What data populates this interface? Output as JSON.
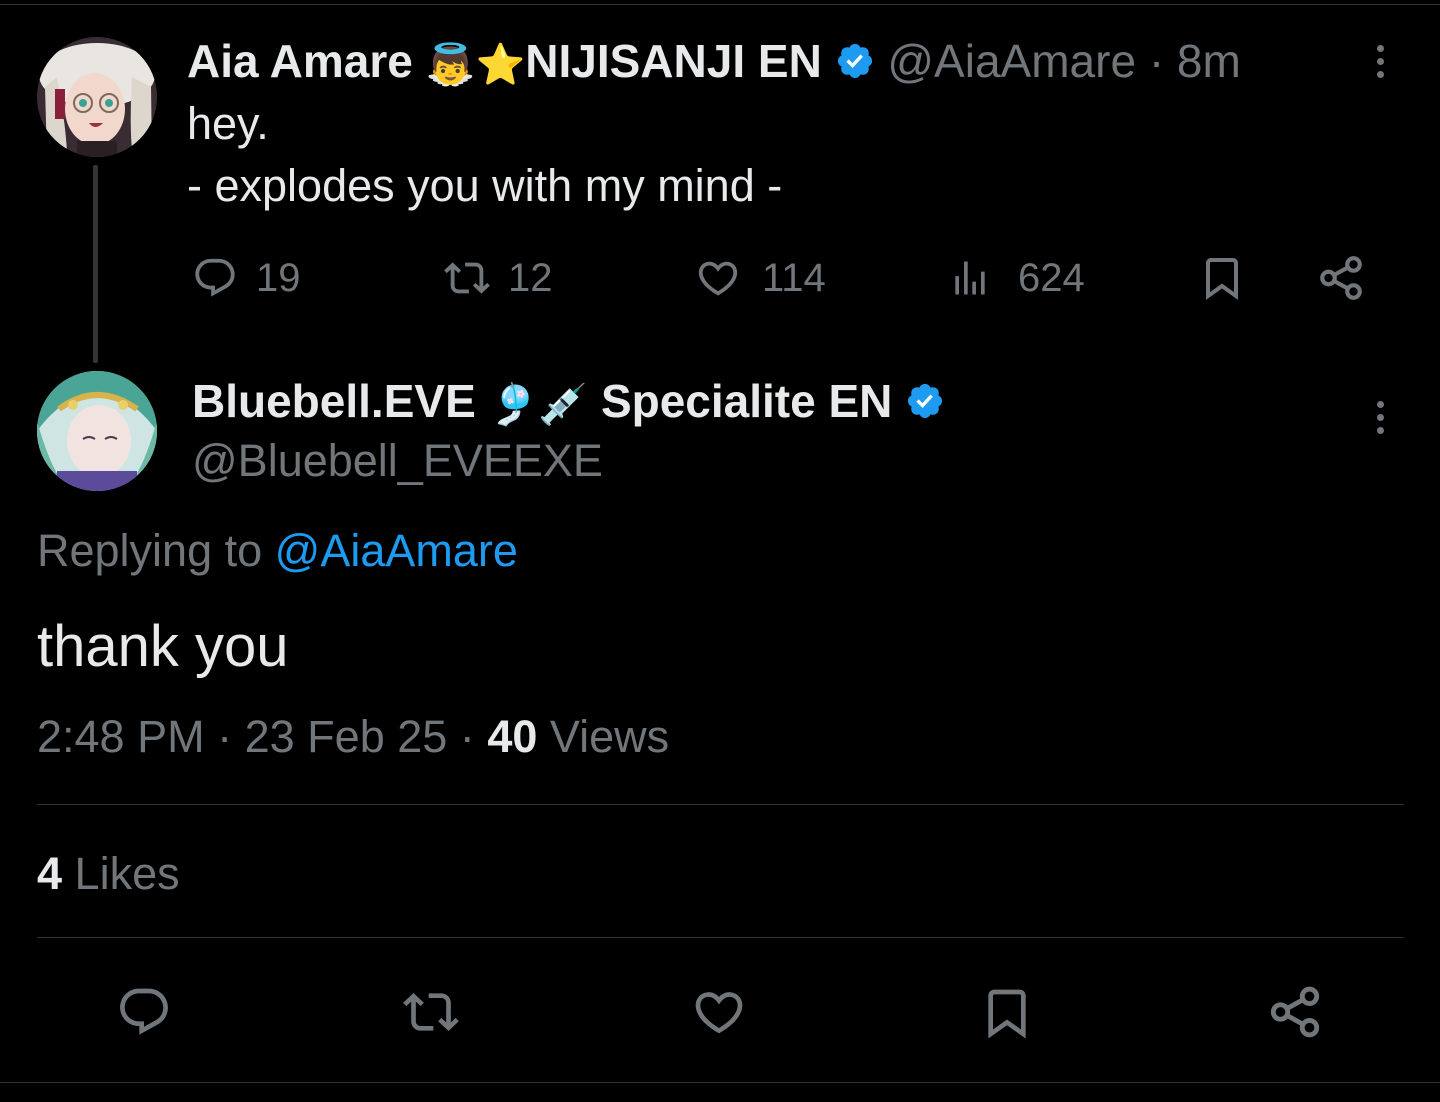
{
  "parent_tweet": {
    "display_name": "Aia Amare",
    "name_emoji_1": "👼",
    "name_emoji_2": "⭐",
    "name_suffix": "NIJISANJI EN",
    "handle": "@AiaAmare",
    "separator": "·",
    "time": "8m",
    "text_line_1": "hey.",
    "text_line_2": "- explodes you with my mind -",
    "replies": "19",
    "retweets": "12",
    "likes": "114",
    "views": "624"
  },
  "reply_tweet": {
    "display_name": "Bluebell.EVE",
    "name_emoji_1": "🎐",
    "name_emoji_2": "💉",
    "name_suffix": "Specialite EN",
    "handle": "@Bluebell_EVEEXE",
    "replying_prefix": "Replying to",
    "replying_to": "@AiaAmare",
    "text": "thank you",
    "timestamp_time": "2:48 PM",
    "timestamp_date": "23 Feb 25",
    "separator": "·",
    "views_count": "40",
    "views_label": "Views",
    "likes_count": "4",
    "likes_label": "Likes"
  },
  "colors": {
    "background": "#000000",
    "text": "#e7e9ea",
    "muted": "#71767b",
    "accent": "#1d9bf0",
    "divider": "#2f3336"
  },
  "icons": [
    "reply-icon",
    "retweet-icon",
    "like-icon",
    "views-icon",
    "bookmark-icon",
    "share-icon",
    "verified-icon",
    "more-icon"
  ]
}
